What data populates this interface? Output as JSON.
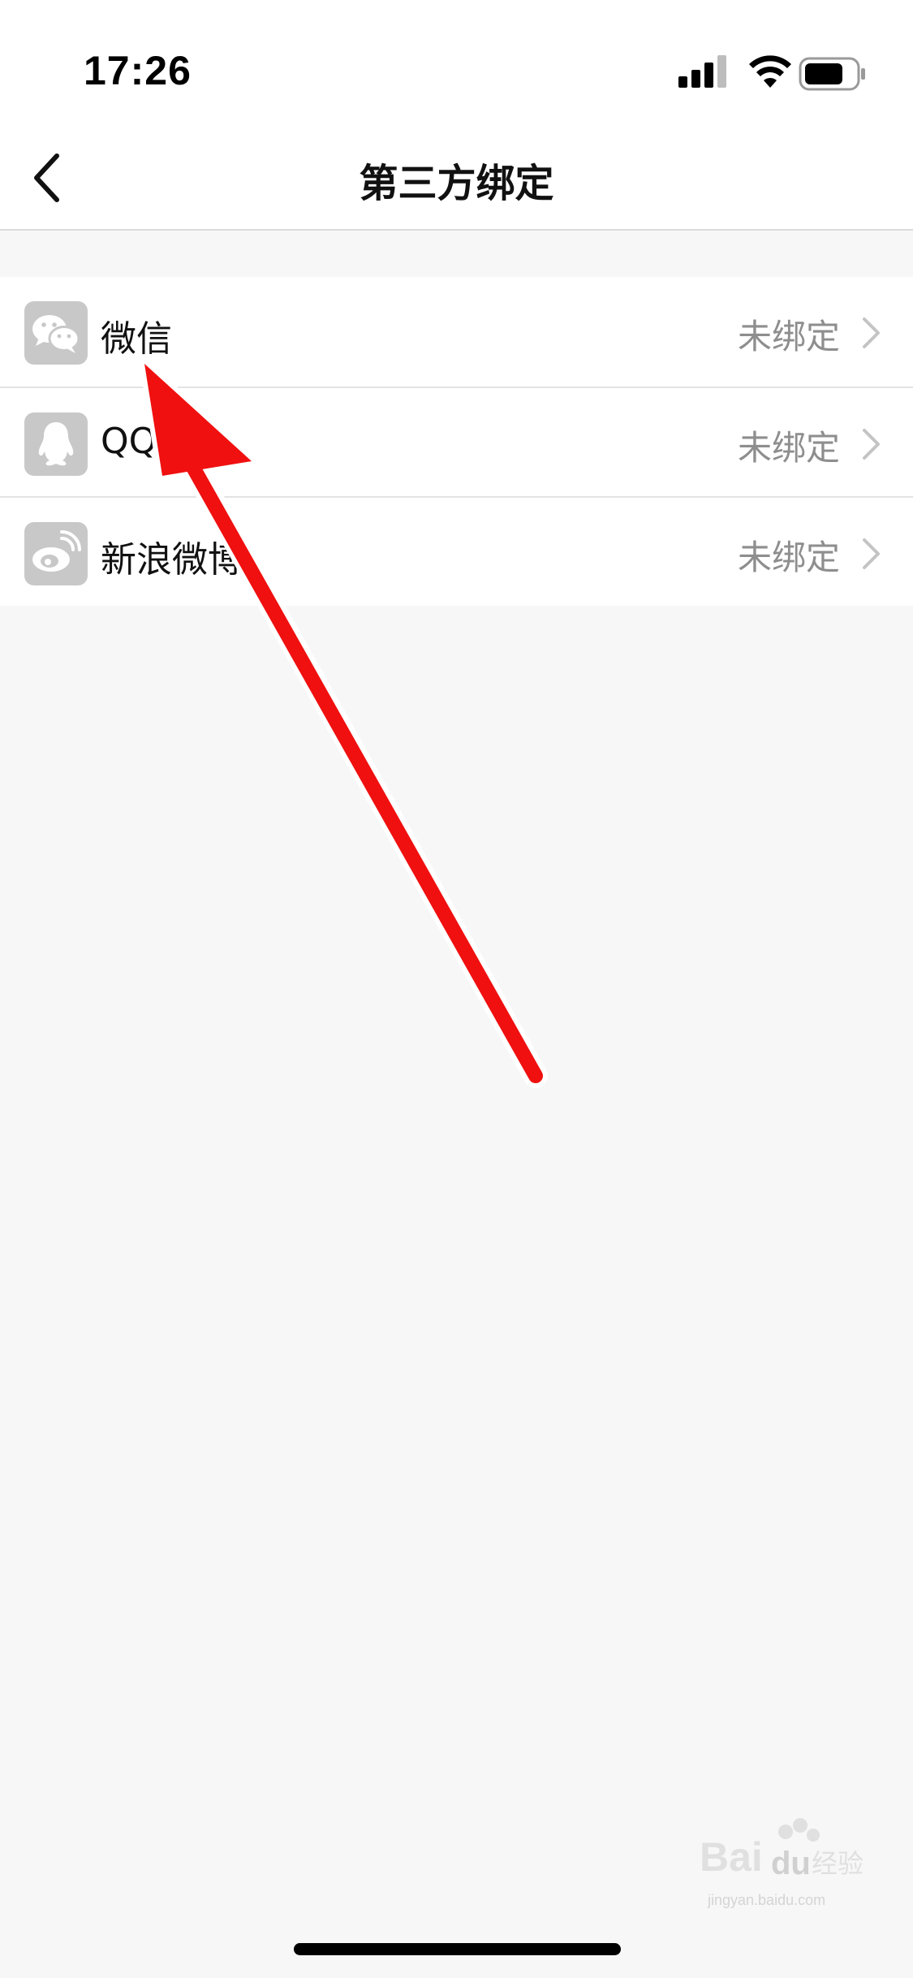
{
  "status_bar": {
    "time": "17:26",
    "icons": [
      "cellular-signal-icon",
      "wifi-icon",
      "battery-icon"
    ]
  },
  "navbar": {
    "title": "第三方绑定",
    "back_icon": "chevron-left-icon"
  },
  "bindings": [
    {
      "label": "微信",
      "status": "未绑定",
      "icon": "wechat-icon"
    },
    {
      "label": "QQ",
      "status": "未绑定",
      "icon": "qq-penguin-icon"
    },
    {
      "label": "新浪微博",
      "status": "未绑定",
      "icon": "weibo-icon"
    }
  ],
  "annotation": {
    "type": "red-arrow",
    "points_to": "微信"
  },
  "watermark": {
    "brand": "Bai du 经验",
    "url": "jingyan.baidu.com"
  },
  "colors": {
    "background": "#f7f7f7",
    "list_background": "#ffffff",
    "icon_background": "#c8c8c8",
    "status_text": "#8e8e8e",
    "arrow": "#f01010"
  }
}
